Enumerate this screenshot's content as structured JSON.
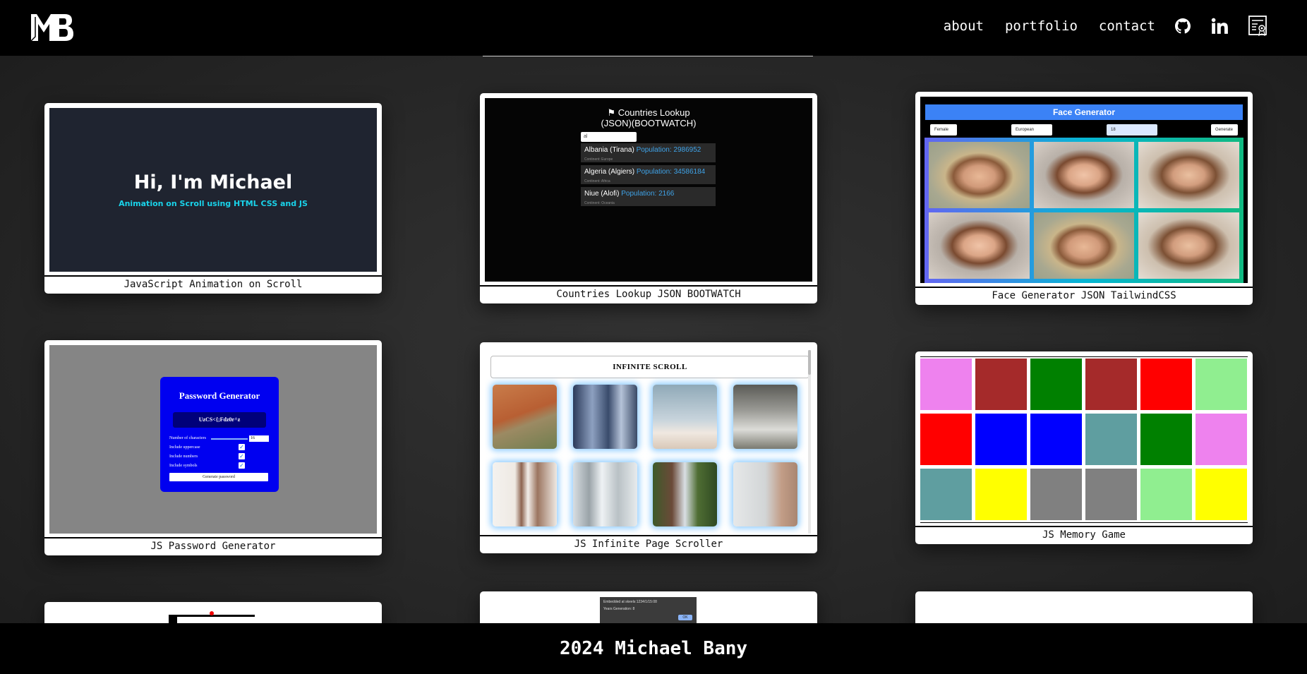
{
  "header": {
    "logo_text": "MB",
    "nav": {
      "about": "about",
      "portfolio": "portfolio",
      "contact": "contact"
    },
    "icons": [
      "github-icon",
      "linkedin-icon",
      "certificate-icon"
    ]
  },
  "projects": [
    {
      "caption": "JavaScript Animation on Scroll",
      "preview": {
        "title": "Hi, I'm Michael",
        "subtitle": "Animation on Scroll using HTML CSS and JS"
      }
    },
    {
      "caption": "Countries Lookup JSON BOOTWATCH",
      "preview": {
        "title_line1": "Countries Lookup",
        "title_line2": "(JSON)(BOOTWATCH)",
        "search_value": "al",
        "results": [
          {
            "name": "Albania (Tirana)",
            "population": "Population: 2986952",
            "region": "Continent: Europe"
          },
          {
            "name": "Algeria (Algiers)",
            "population": "Population: 34586184",
            "region": "Continent: Africa"
          },
          {
            "name": "Niue (Alofi)",
            "population": "Population: 2166",
            "region": "Continent: Oceania"
          }
        ]
      }
    },
    {
      "caption": "Face Generator JSON TailwindCSS",
      "preview": {
        "title": "Face Generator",
        "gender": "Female",
        "ethnicity": "European",
        "age": "18",
        "button": "Generate"
      }
    },
    {
      "caption": "JS Password Generator",
      "preview": {
        "title": "Password Generator",
        "password": "UzCS<{;Fdz0r^z",
        "length_label": "Number of characters",
        "length_value": "16",
        "opt_upper": "Include uppercase",
        "opt_numbers": "Include numbers",
        "opt_symbols": "Include symbols",
        "button": "Generate password"
      }
    },
    {
      "caption": "JS Infinite Page Scroller",
      "preview": {
        "title": "INFINITE SCROLL"
      }
    },
    {
      "caption": "JS Memory Game",
      "preview": {
        "tiles": [
          "#ee82ee",
          "#a52a2a",
          "#008000",
          "#a52a2a",
          "#ff0000",
          "#90ee90",
          "#ff0000",
          "#0000ff",
          "#0000ff",
          "#5f9ea0",
          "#008000",
          "#ee82ee",
          "#5f9ea0",
          "#ffff00",
          "#808080",
          "#808080",
          "#90ee90",
          "#ffff00"
        ]
      }
    },
    {
      "caption": "",
      "preview": {}
    },
    {
      "caption": "",
      "preview": {
        "dialog_line1": "Embedded at skeels:1234/1/15:08",
        "dialog_line2": "Years Generation: 8",
        "dialog_ok": "OK"
      }
    },
    {
      "caption": "",
      "preview": {}
    }
  ],
  "footer": {
    "text": "2024 Michael Bany"
  },
  "colors": {
    "header_bg": "#000000",
    "page_bg": "#2a2a2a",
    "accent_cyan": "#19d3ea",
    "tailwind_blue": "#3b82f6",
    "password_blue": "#0000f0"
  }
}
